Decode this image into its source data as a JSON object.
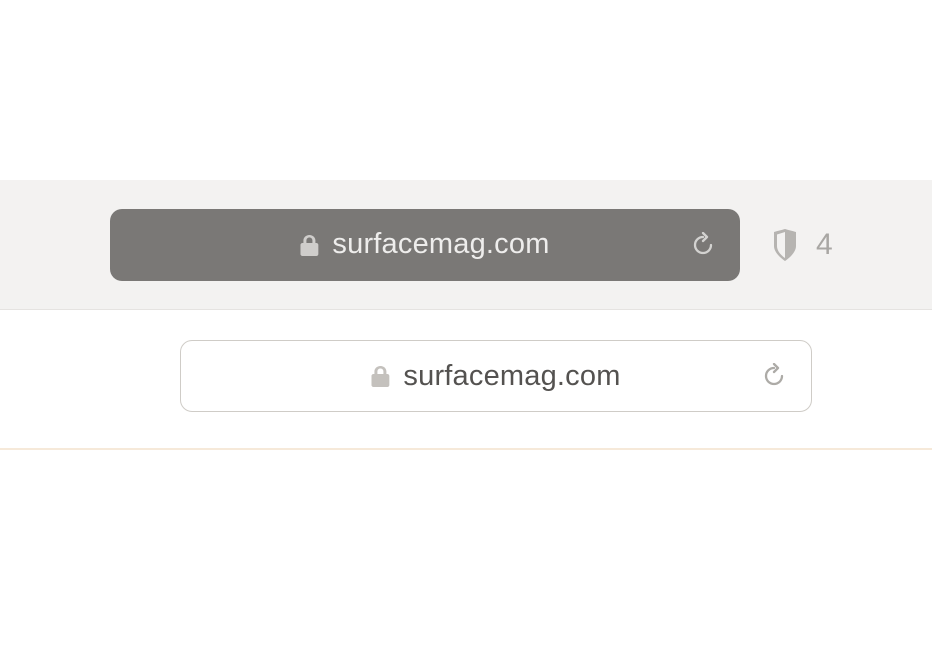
{
  "toolbar": {
    "dark": {
      "url": "surfacemag.com"
    },
    "privacy": {
      "count": "4"
    },
    "light": {
      "url": "surfacemag.com"
    }
  },
  "colors": {
    "toolbar_bg": "#f3f2f1",
    "dark_pill": "#7a7876",
    "light_border": "#cfccc7"
  }
}
